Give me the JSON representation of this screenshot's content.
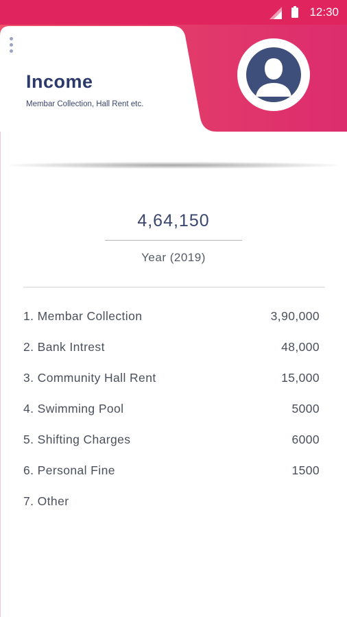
{
  "status_bar": {
    "time": "12:30",
    "icons": [
      "signal-icon",
      "battery-icon"
    ],
    "color": "#e0245e"
  },
  "header": {
    "title": "Income",
    "subtitle": "Membar Collection, Hall Rent etc.",
    "menu_icon": "more-vertical-icon",
    "avatar_icon": "user-avatar-icon",
    "accent_color": "#e23a6b"
  },
  "summary": {
    "total": "4,64,150",
    "period_label": "Year (2019)"
  },
  "income_items": [
    {
      "label": "1. Membar Collection",
      "value": "3,90,000"
    },
    {
      "label": "2. Bank Intrest",
      "value": "48,000"
    },
    {
      "label": "3. Community Hall Rent",
      "value": "15,000"
    },
    {
      "label": "4. Swimming Pool",
      "value": "5000"
    },
    {
      "label": "5. Shifting Charges",
      "value": "6000"
    },
    {
      "label": "6. Personal Fine",
      "value": "1500"
    },
    {
      "label": "7. Other",
      "value": ""
    }
  ]
}
